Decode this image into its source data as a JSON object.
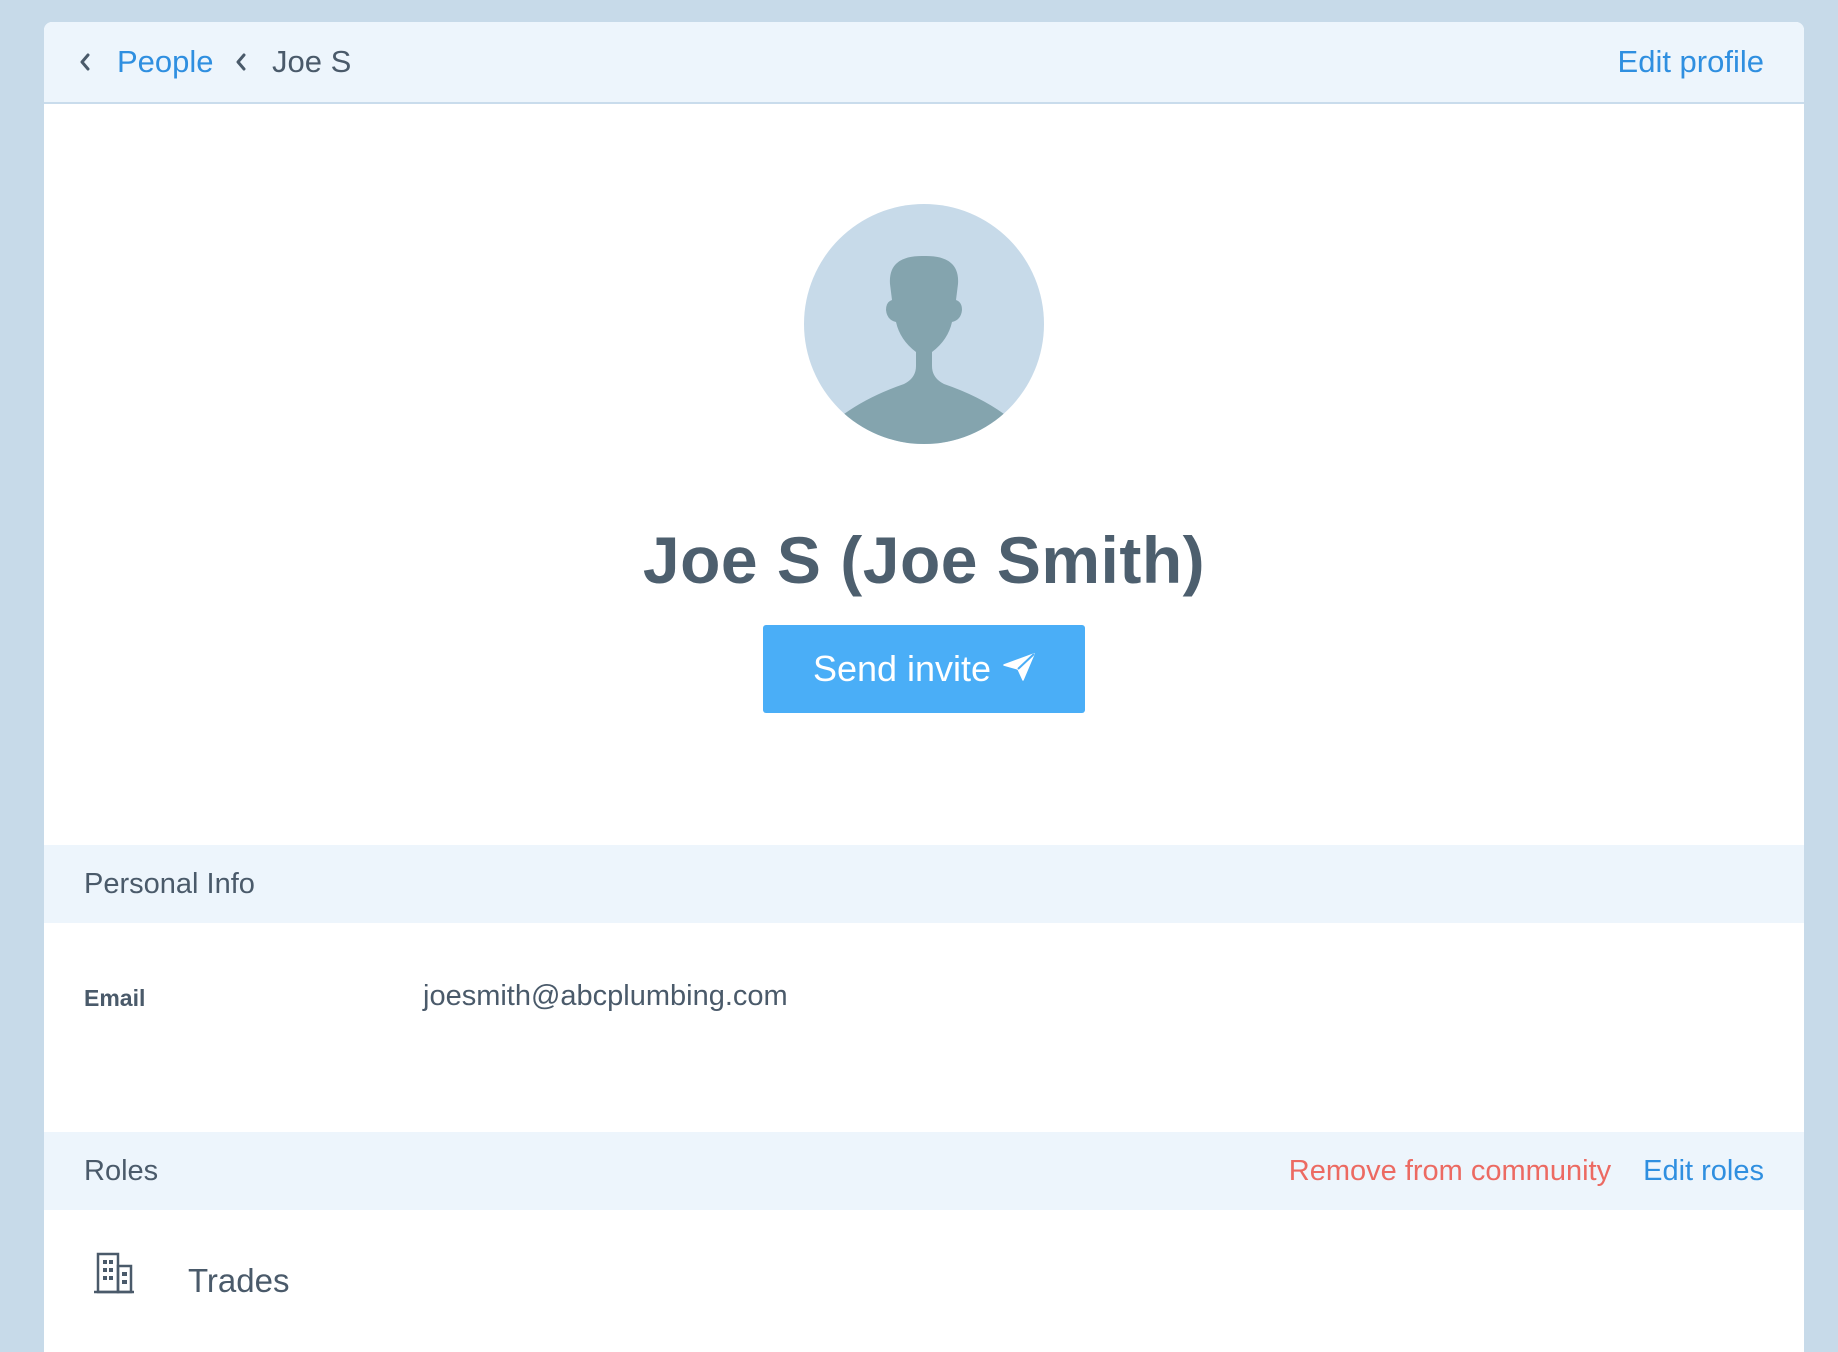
{
  "breadcrumb": {
    "parent_label": "People",
    "current_label": "Joe S"
  },
  "header": {
    "edit_profile_label": "Edit profile"
  },
  "profile": {
    "display_name": "Joe S (Joe Smith)",
    "send_invite_label": "Send invite"
  },
  "personal_info": {
    "title": "Personal Info",
    "fields": [
      {
        "label": "Email",
        "value": "joesmith@abcplumbing.com"
      }
    ]
  },
  "roles": {
    "title": "Roles",
    "remove_label": "Remove from community",
    "edit_label": "Edit roles",
    "items": [
      {
        "name": "Trades",
        "icon": "building-icon"
      }
    ]
  },
  "colors": {
    "page_background": "#c7dae9",
    "accent_link": "#2f8fe0",
    "button_primary": "#4aaef7",
    "danger": "#ec6a62",
    "text": "#4a5a6a"
  }
}
